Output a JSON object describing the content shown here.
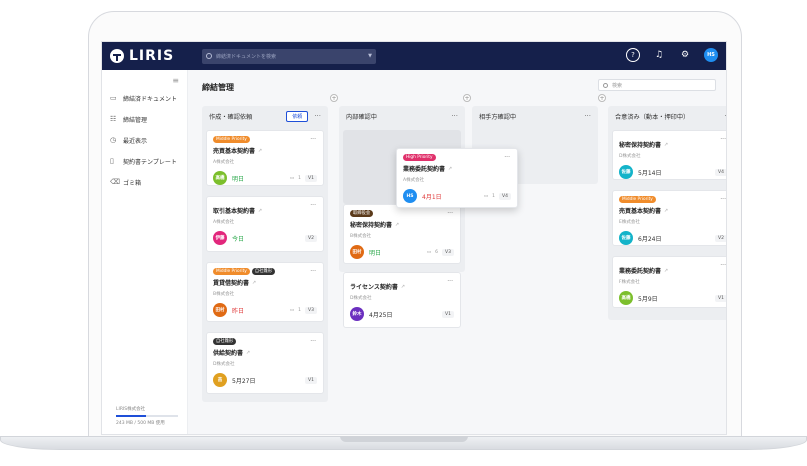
{
  "app": {
    "name": "LIRIS",
    "search_placeholder": "締結済ドキュメントを検索",
    "user_initials": "HS"
  },
  "icons": {
    "help": "help-icon",
    "bell": "bell-icon",
    "gear": "gear-icon"
  },
  "sidebar": {
    "items": [
      {
        "label": "締結済ドキュメント",
        "icon": "document-icon",
        "glyph": "▭"
      },
      {
        "label": "締結管理",
        "icon": "board-icon",
        "glyph": "☷"
      },
      {
        "label": "最近表示",
        "icon": "clock-icon",
        "glyph": "◷"
      },
      {
        "label": "契約書テンプレート",
        "icon": "template-icon",
        "glyph": "▯"
      },
      {
        "label": "ゴミ箱",
        "icon": "trash-icon",
        "glyph": "🗑"
      }
    ],
    "org": "LIRIS株式会社",
    "storage": "243 MB / 500 MB 使用",
    "storage_fraction": 0.486
  },
  "main": {
    "title": "締結管理",
    "search_placeholder": "検索"
  },
  "columns": [
    {
      "title": "作成・確認依頼",
      "add_label": "依頼"
    },
    {
      "title": "内部確認中"
    },
    {
      "title": "相手方確認中"
    },
    {
      "title": "合意済み（動本・押印中）"
    }
  ],
  "cards": {
    "c1": {
      "badges": [
        "Middle Priority"
      ],
      "title": "売買基本契約書",
      "company": "A株式会社",
      "assignee": "高橋",
      "date": "明日",
      "comments": "1",
      "version": "V1"
    },
    "c2": {
      "badges": [],
      "title": "取引基本契約書",
      "company": "A株式会社",
      "assignee": "伊藤",
      "date": "今日",
      "version": "V2"
    },
    "c3": {
      "badges": [
        "Middle Priority",
        "自社雛形"
      ],
      "title": "賃貸借契約書",
      "company": "B株式会社",
      "assignee": "田村",
      "date": "昨日",
      "comments": "1",
      "version": "V3"
    },
    "c4": {
      "badges": [
        "自社雛形"
      ],
      "title": "供給契約書",
      "company": "D株式会社",
      "assignee": "苗",
      "date": "5月27日",
      "version": "V1"
    },
    "c5": {
      "badges": [
        "取締役会"
      ],
      "title": "秘密保持契約書",
      "company": "B株式会社",
      "assignee": "田村",
      "date": "明日",
      "comments": "6",
      "version": "V3"
    },
    "c6": {
      "badges": [],
      "title": "ライセンス契約書",
      "company": "D株式会社",
      "assignee": "鈴木",
      "date": "4月25日",
      "version": "V1"
    },
    "c7": {
      "badges": [
        "High Priority"
      ],
      "title": "業務委託契約書",
      "company": "A株式会社",
      "assignee": "HS",
      "date": "4月1日",
      "comments": "1",
      "version": "V4"
    },
    "c8": {
      "badges": [],
      "title": "秘密保持契約書",
      "company": "D株式会社",
      "assignee": "佐藤",
      "date": "5月14日",
      "version": "V4"
    },
    "c9": {
      "badges": [
        "Middle Priority"
      ],
      "title": "売買基本契約書",
      "company": "E株式会社",
      "assignee": "佐藤",
      "date": "6月24日",
      "version": "V2"
    },
    "c10": {
      "badges": [],
      "title": "業務委託契約書",
      "company": "F株式会社",
      "assignee": "高橋",
      "date": "5月9日",
      "version": "V1"
    }
  },
  "colors": {
    "navy": "#15204b",
    "accent": "#1f4fd8"
  }
}
